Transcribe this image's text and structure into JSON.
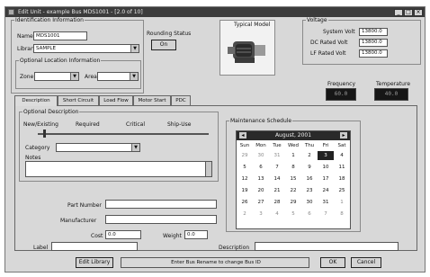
{
  "window": {
    "title": "Edit Unit - example Bus MDS1001 - [2.0 of 10]",
    "min_label": "_",
    "max_label": "□",
    "close_label": "×"
  },
  "identification": {
    "group_label": "Identification Information",
    "name_label": "Name",
    "name_value": "MDS1001",
    "library_label": "Library",
    "library_value": "SAMPLE",
    "optional_location_label": "Optional Location Information",
    "zone_label": "Zone",
    "zone_value": "",
    "area_label": "Area",
    "area_value": ""
  },
  "rounding_status": {
    "label": "Rounding Status",
    "button": "On"
  },
  "typical_model": {
    "label": "Typical Model"
  },
  "voltage": {
    "group_label": "Voltage",
    "system_label": "System Volt",
    "system_value": "13800.0",
    "dc_label": "DC Rated Volt",
    "dc_value": "13800.0",
    "lf_label": "LF Rated Volt",
    "lf_value": "13800.0"
  },
  "frequency": {
    "label": "Frequency",
    "value": "60.0"
  },
  "temperature": {
    "label": "Temperature",
    "value": "40.0"
  },
  "tabs": [
    "Description",
    "Short Circuit",
    "Load Flow",
    "Motor Start",
    "PDC"
  ],
  "active_tab": 0,
  "description": {
    "group_label": "Optional Description",
    "slider_labels": [
      "New/Existing",
      "Required",
      "Critical",
      "Ship-Use"
    ],
    "category_label": "Category",
    "category_value": "",
    "notes_label": "Notes",
    "notes_value": "",
    "part_number_label": "Part Number",
    "part_number_value": "",
    "manufacturer_label": "Manufacturer",
    "manufacturer_value": "",
    "cost_label": "Cost",
    "cost_value": "0.0",
    "weight_label": "Weight",
    "weight_value": "0.0",
    "label_label": "Label",
    "label_value": "",
    "desc_label": "Description",
    "desc_value": ""
  },
  "maintenance": {
    "group_label": "Maintenance Schedule",
    "month_title": "August, 2001",
    "prev": "◂",
    "next": "▸",
    "weekdays": [
      "Sun",
      "Mon",
      "Tue",
      "Wed",
      "Thu",
      "Fri",
      "Sat"
    ],
    "weeks": [
      [
        "29",
        "30",
        "31",
        "1",
        "2",
        "3",
        "4"
      ],
      [
        "5",
        "6",
        "7",
        "8",
        "9",
        "10",
        "11"
      ],
      [
        "12",
        "13",
        "14",
        "15",
        "16",
        "17",
        "18"
      ],
      [
        "19",
        "20",
        "21",
        "22",
        "23",
        "24",
        "25"
      ],
      [
        "26",
        "27",
        "28",
        "29",
        "30",
        "31",
        "1"
      ],
      [
        "2",
        "3",
        "4",
        "5",
        "6",
        "7",
        "8"
      ]
    ],
    "selected_day": "3"
  },
  "footer": {
    "edit_library": "Edit Library",
    "status": "Enter Bus Rename to change Bus ID",
    "ok": "OK",
    "cancel": "Cancel"
  }
}
